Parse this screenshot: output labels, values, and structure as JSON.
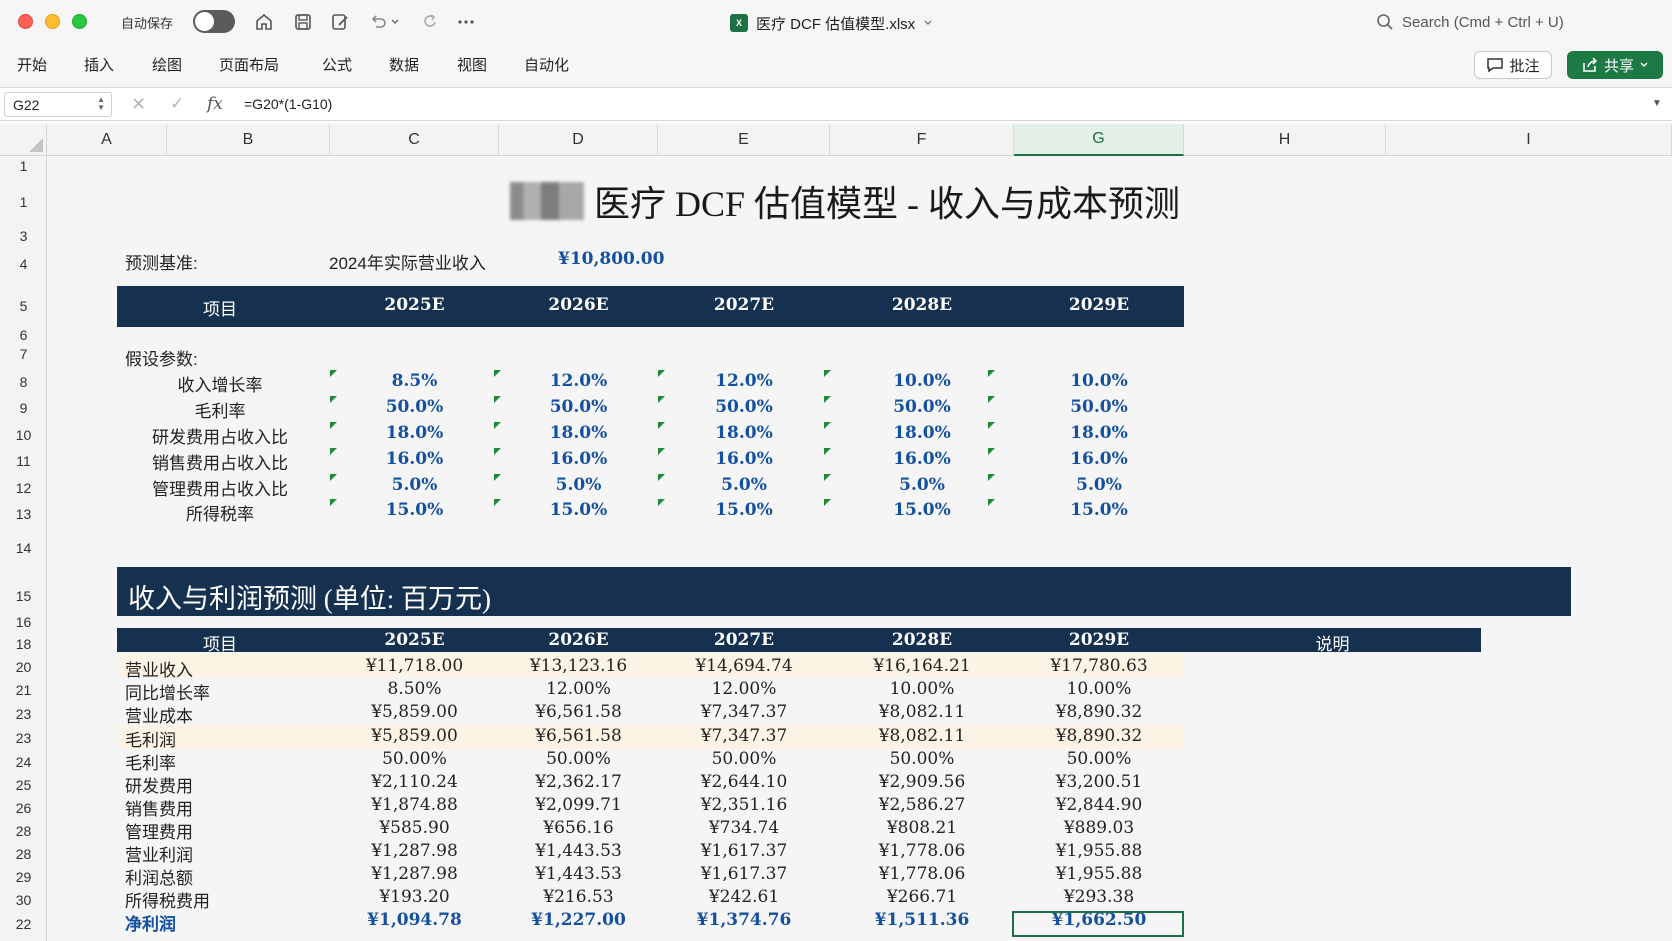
{
  "titlebar": {
    "autosave_label": "自动保存",
    "file_name": "医疗 DCF 估值模型.xlsx",
    "xlsx_badge": "X",
    "search_placeholder": "Search (Cmd + Ctrl + U)"
  },
  "ribbon": {
    "tabs": [
      "开始",
      "插入",
      "绘图",
      "页面布局",
      "公式",
      "数据",
      "视图",
      "自动化"
    ],
    "comment_label": "批注",
    "share_label": "共享"
  },
  "formula_bar": {
    "cell_ref": "G22",
    "formula": "=G20*(1-G10)"
  },
  "grid": {
    "columns": [
      "A",
      "B",
      "C",
      "D",
      "E",
      "F",
      "G",
      "H",
      "I"
    ],
    "selected_column": "G",
    "row_numbers": [
      "1",
      "1",
      "3",
      "4",
      "5",
      "6",
      "7",
      "8",
      "9",
      "10",
      "11",
      "12",
      "13",
      "14",
      "15",
      "16",
      "18",
      "20",
      "21",
      "23",
      "23",
      "24",
      "25",
      "26",
      "28",
      "28",
      "29",
      "30",
      "22"
    ]
  },
  "sheet": {
    "title": "医疗 DCF 估值模型 - 收入与成本预测",
    "basis_label": "预测基准:",
    "basis_desc": "2024年实际营业收入",
    "basis_value": "¥10,800.00",
    "years": [
      "2025E",
      "2026E",
      "2027E",
      "2028E",
      "2029E"
    ],
    "header_item": "项目",
    "assumptions_label": "假设参数:",
    "assumptions": [
      {
        "label": "收入增长率",
        "values": [
          "8.5%",
          "12.0%",
          "12.0%",
          "10.0%",
          "10.0%"
        ]
      },
      {
        "label": "毛利率",
        "values": [
          "50.0%",
          "50.0%",
          "50.0%",
          "50.0%",
          "50.0%"
        ]
      },
      {
        "label": "研发费用占收入比",
        "values": [
          "18.0%",
          "18.0%",
          "18.0%",
          "18.0%",
          "18.0%"
        ]
      },
      {
        "label": "销售费用占收入比",
        "values": [
          "16.0%",
          "16.0%",
          "16.0%",
          "16.0%",
          "16.0%"
        ]
      },
      {
        "label": "管理费用占收入比",
        "values": [
          "5.0%",
          "5.0%",
          "5.0%",
          "5.0%",
          "5.0%"
        ]
      },
      {
        "label": "所得税率",
        "values": [
          "15.0%",
          "15.0%",
          "15.0%",
          "15.0%",
          "15.0%"
        ]
      }
    ],
    "section_title": "收入与利润预测 (单位: 百万元)",
    "notes_header": "说明",
    "forecast": [
      {
        "label": "营业收入",
        "values": [
          "¥11,718.00",
          "¥13,123.16",
          "¥14,694.74",
          "¥16,164.21",
          "¥17,780.63"
        ]
      },
      {
        "label": "同比增长率",
        "values": [
          "8.50%",
          "12.00%",
          "12.00%",
          "10.00%",
          "10.00%"
        ]
      },
      {
        "label": "营业成本",
        "values": [
          "¥5,859.00",
          "¥6,561.58",
          "¥7,347.37",
          "¥8,082.11",
          "¥8,890.32"
        ]
      },
      {
        "label": "毛利润",
        "values": [
          "¥5,859.00",
          "¥6,561.58",
          "¥7,347.37",
          "¥8,082.11",
          "¥8,890.32"
        ]
      },
      {
        "label": "毛利率",
        "values": [
          "50.00%",
          "50.00%",
          "50.00%",
          "50.00%",
          "50.00%"
        ]
      },
      {
        "label": "研发费用",
        "values": [
          "¥2,110.24",
          "¥2,362.17",
          "¥2,644.10",
          "¥2,909.56",
          "¥3,200.51"
        ]
      },
      {
        "label": "销售费用",
        "values": [
          "¥1,874.88",
          "¥2,099.71",
          "¥2,351.16",
          "¥2,586.27",
          "¥2,844.90"
        ]
      },
      {
        "label": "管理费用",
        "values": [
          "¥585.90",
          "¥656.16",
          "¥734.74",
          "¥808.21",
          "¥889.03"
        ]
      },
      {
        "label": "营业利润",
        "values": [
          "¥1,287.98",
          "¥1,443.53",
          "¥1,617.37",
          "¥1,778.06",
          "¥1,955.88"
        ]
      },
      {
        "label": "利润总额",
        "values": [
          "¥1,287.98",
          "¥1,443.53",
          "¥1,617.37",
          "¥1,778.06",
          "¥1,955.88"
        ]
      },
      {
        "label": "所得税费用",
        "values": [
          "¥193.20",
          "¥216.53",
          "¥242.61",
          "¥266.71",
          "¥293.38"
        ]
      },
      {
        "label": "净利润",
        "values": [
          "¥1,094.78",
          "¥1,227.00",
          "¥1,374.76",
          "¥1,511.36",
          "¥1,662.50"
        ]
      }
    ]
  },
  "colors": {
    "navy": "#16314f",
    "input_blue": "#1450a0",
    "excel_green": "#1e7145",
    "highlight_row": "#fdf3e4"
  }
}
